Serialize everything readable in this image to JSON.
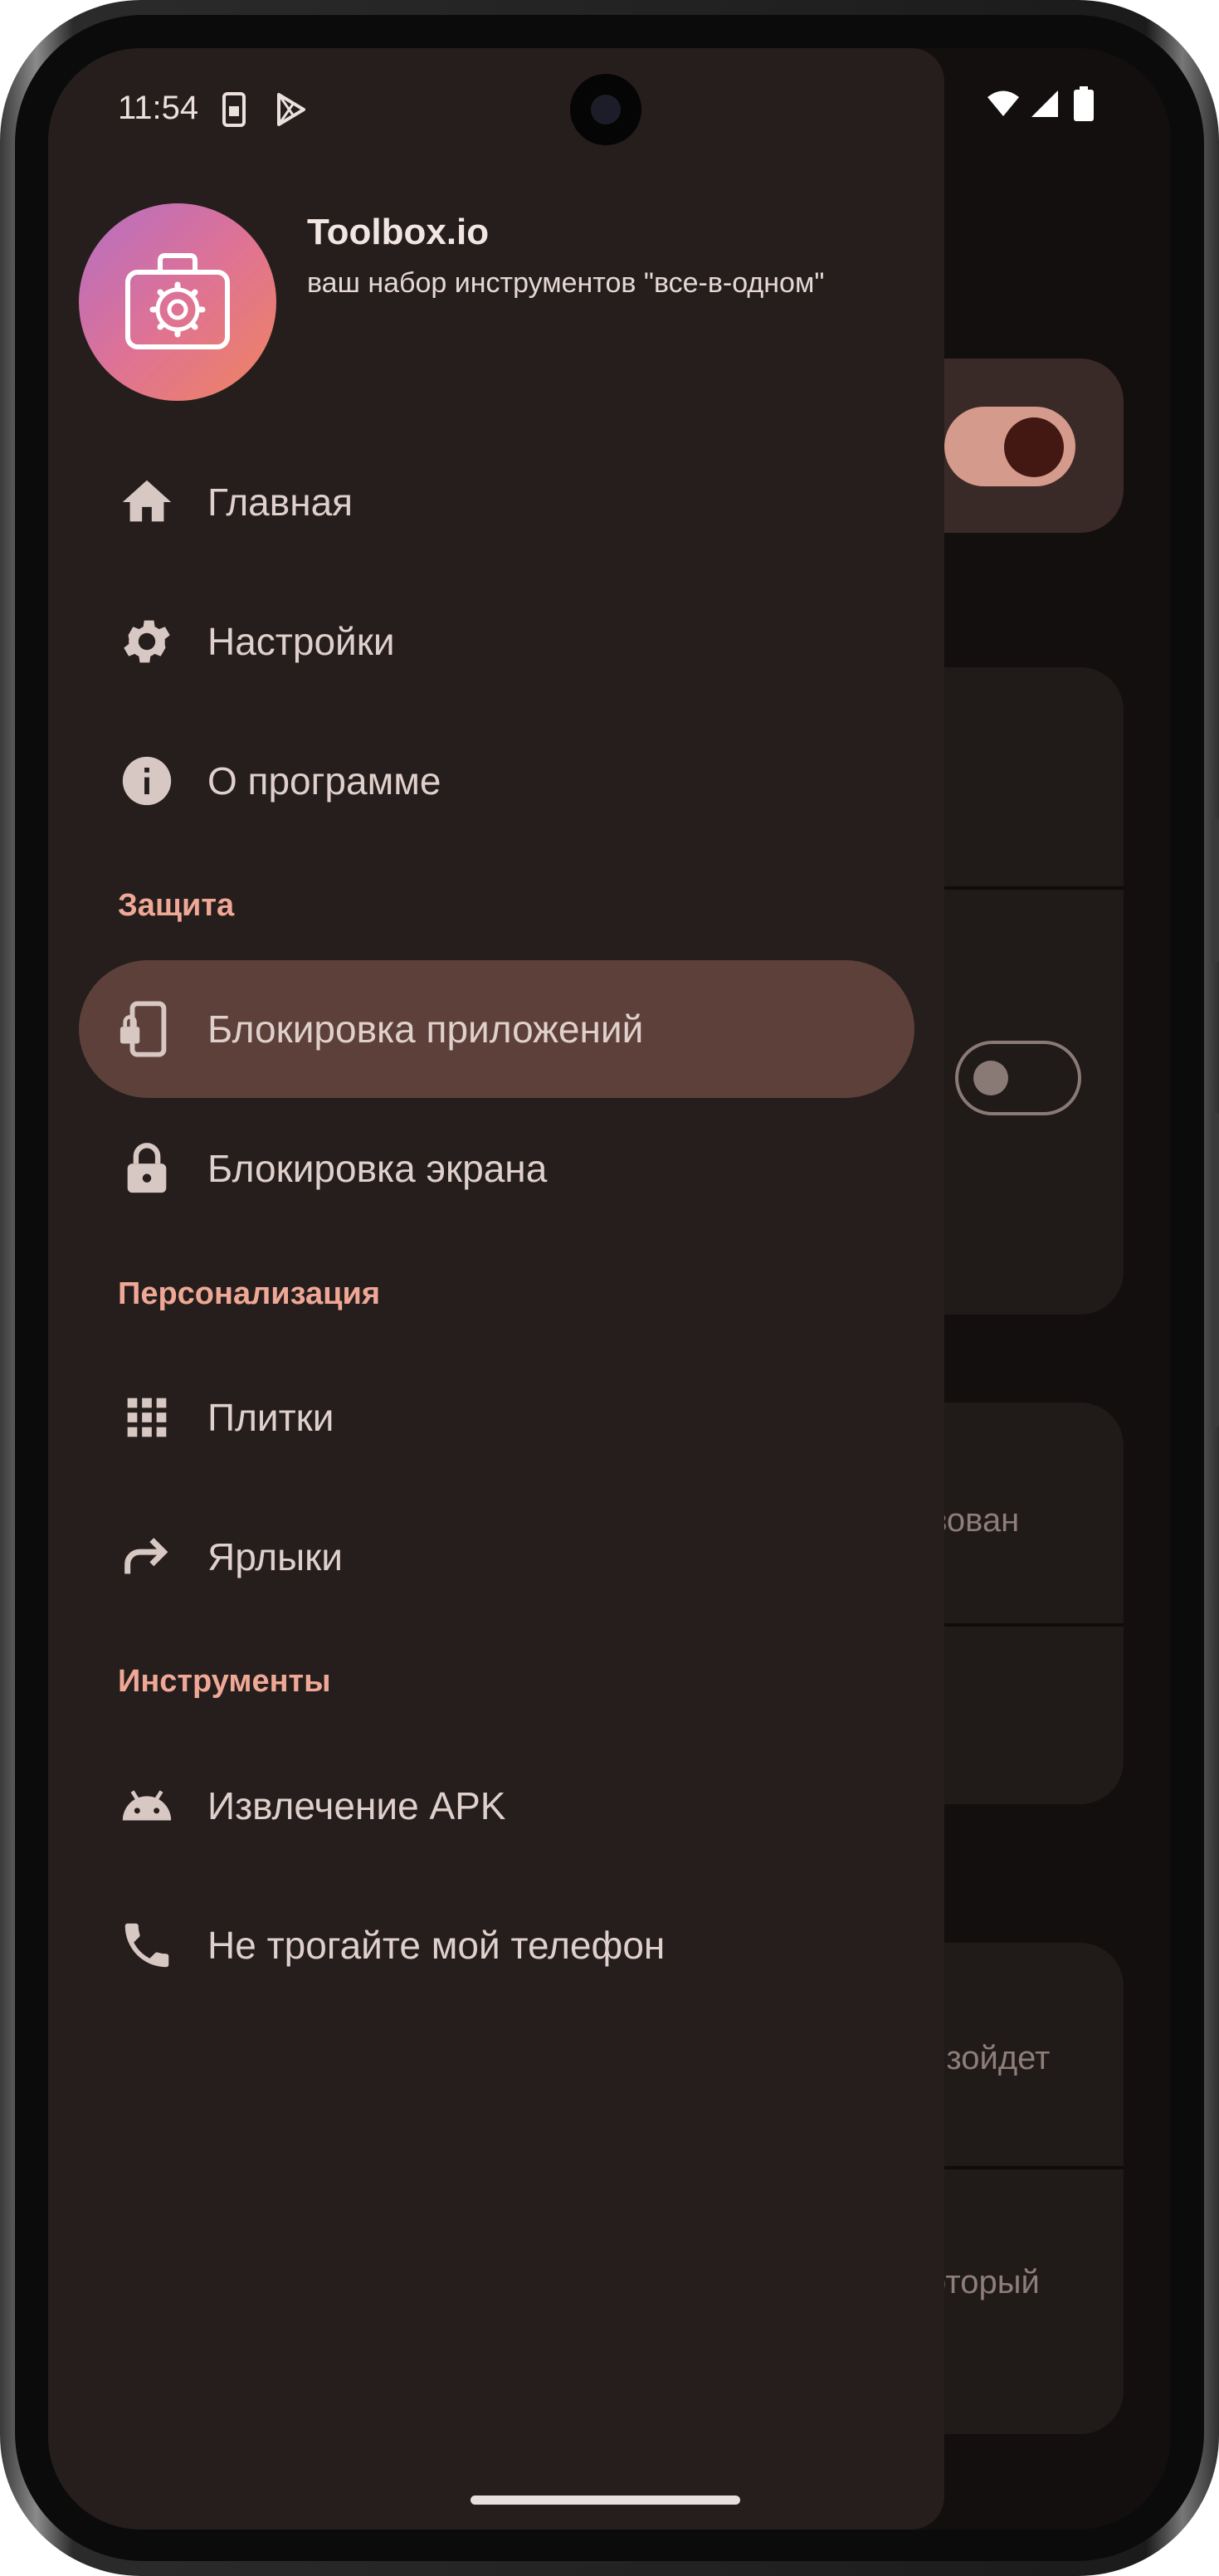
{
  "status_bar": {
    "time": "11:54"
  },
  "drawer": {
    "app_name": "Toolbox.io",
    "app_subtitle": "ваш набор инструментов \"все-в-одном\"",
    "items": [
      {
        "label": "Главная",
        "icon": "home-icon"
      },
      {
        "label": "Настройки",
        "icon": "gear-icon"
      },
      {
        "label": "О программе",
        "icon": "info-icon"
      }
    ],
    "sections": [
      {
        "title": "Защита",
        "items": [
          {
            "label": "Блокировка приложений",
            "icon": "phone-lock-icon",
            "active": true
          },
          {
            "label": "Блокировка экрана",
            "icon": "lock-icon"
          }
        ]
      },
      {
        "title": "Персонализация",
        "items": [
          {
            "label": "Плитки",
            "icon": "grid-icon"
          },
          {
            "label": "Ярлыки",
            "icon": "shortcut-arrow-icon"
          }
        ]
      },
      {
        "title": "Инструменты",
        "items": [
          {
            "label": "Извлечение APK",
            "icon": "android-icon"
          },
          {
            "label": "Не трогайте мой телефон",
            "icon": "phone-icon"
          }
        ]
      }
    ]
  },
  "background": {
    "fragment_1": "зован",
    "fragment_2": "изойдет",
    "fragment_3": "оторый"
  },
  "colors": {
    "drawer_bg": "#251e1c",
    "active_item_bg": "#5e403a",
    "section_title": "#f0a896",
    "accent_toggle": "#d49a8c"
  }
}
